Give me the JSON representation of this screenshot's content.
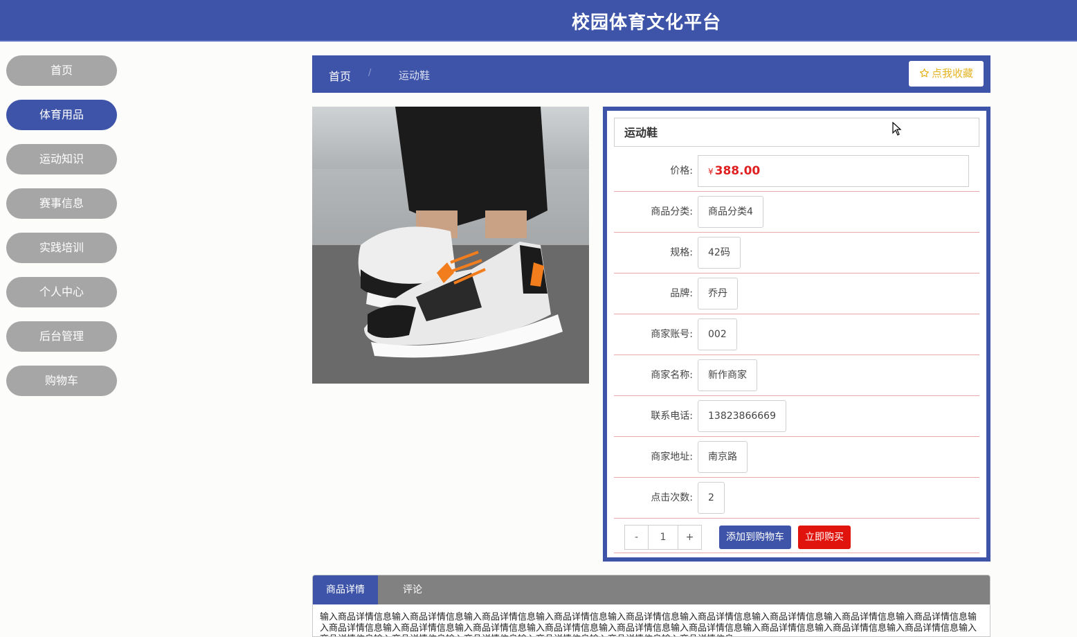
{
  "header": {
    "title": "校园体育文化平台"
  },
  "sidebar": {
    "items": [
      {
        "label": "首页",
        "active": false
      },
      {
        "label": "体育用品",
        "active": true
      },
      {
        "label": "运动知识",
        "active": false
      },
      {
        "label": "赛事信息",
        "active": false
      },
      {
        "label": "实践培训",
        "active": false
      },
      {
        "label": "个人中心",
        "active": false
      },
      {
        "label": "后台管理",
        "active": false
      },
      {
        "label": "购物车",
        "active": false
      }
    ]
  },
  "breadcrumb": {
    "home": "首页",
    "separator": "/",
    "current": "运动鞋"
  },
  "favorite_button": {
    "icon": "star-outline-icon",
    "label": "点我收藏"
  },
  "product": {
    "name": "运动鞋",
    "image_alt": "product-photo-sneakers",
    "price_currency": "¥",
    "price_value": "388.00",
    "fields": [
      {
        "label": "商品分类:",
        "value": "商品分类4"
      },
      {
        "label": "规格:",
        "value": "42码"
      },
      {
        "label": "品牌:",
        "value": "乔丹"
      },
      {
        "label": "商家账号:",
        "value": "002"
      },
      {
        "label": "商家名称:",
        "value": "新作商家"
      },
      {
        "label": "联系电话:",
        "value": "13823866669"
      },
      {
        "label": "商家地址:",
        "value": "南京路"
      },
      {
        "label": "点击次数:",
        "value": "2"
      }
    ],
    "price_label": "价格:"
  },
  "quantity": {
    "minus": "-",
    "value": "1",
    "plus": "+"
  },
  "actions": {
    "add_to_cart": "添加到购物车",
    "buy_now": "立即购买"
  },
  "tabs": {
    "items": [
      {
        "label": "商品详情",
        "active": true
      },
      {
        "label": "评论",
        "active": false
      }
    ],
    "detail_text": "输入商品详情信息输入商品详情信息输入商品详情信息输入商品详情信息输入商品详情信息输入商品详情信息输入商品详情信息输入商品详情信息输入商品详情信息输入商品详情信息输入商品详情信息输入商品详情信息输入商品详情信息输入商品详情信息输入商品详情信息输入商品详情信息输入商品详情信息输入商品详情信息输入商品详情信息输入商品详情信息输入商品详情信息输入商品详情信息输入商品详情信息输入商品详情信息"
  },
  "colors": {
    "primary": "#3d54a9",
    "sidebar_inactive": "#a6a6a6",
    "price": "#e02020",
    "buy": "#e0140c",
    "favorite": "#e6b422",
    "tab_bar": "#818181"
  }
}
